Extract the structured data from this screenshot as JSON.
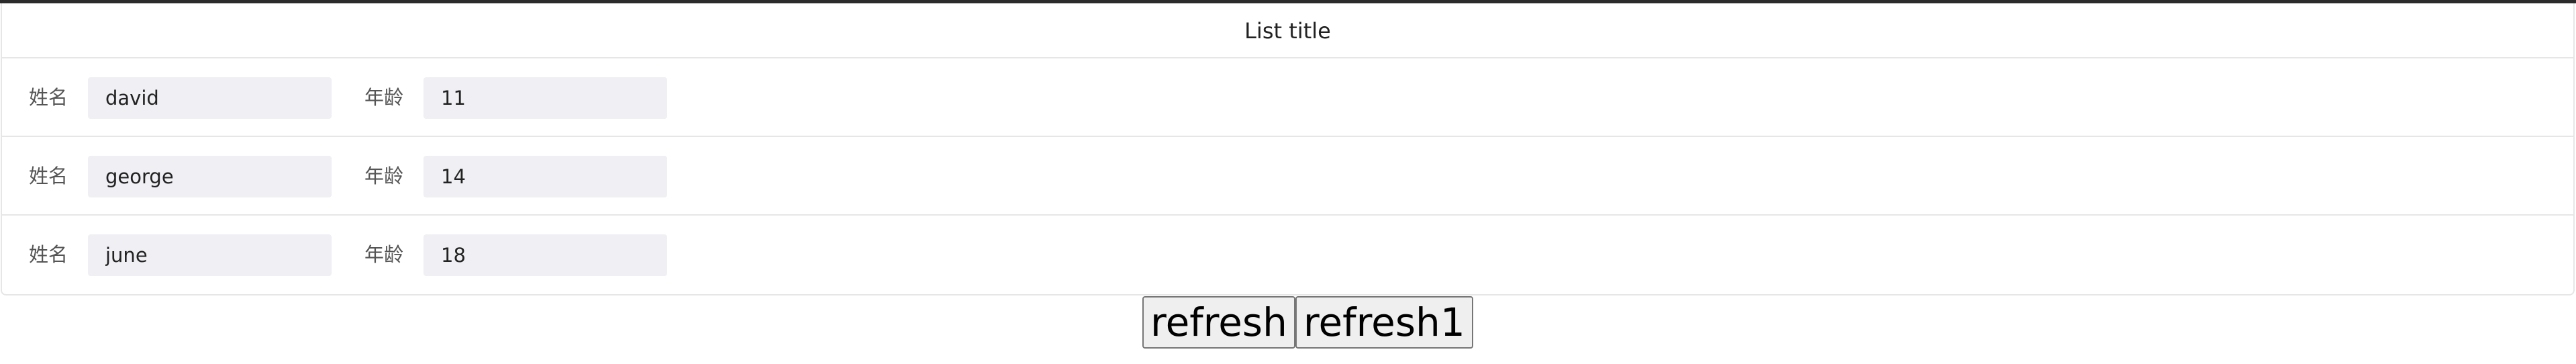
{
  "list": {
    "title": "List title",
    "rows": [
      {
        "name_label": "姓名",
        "name": "david",
        "age_label": "年龄",
        "age": "11"
      },
      {
        "name_label": "姓名",
        "name": "george",
        "age_label": "年龄",
        "age": "14"
      },
      {
        "name_label": "姓名",
        "name": "june",
        "age_label": "年龄",
        "age": "18"
      }
    ]
  },
  "buttons": {
    "refresh_label": "refresh",
    "refresh1_label": "refresh1"
  }
}
